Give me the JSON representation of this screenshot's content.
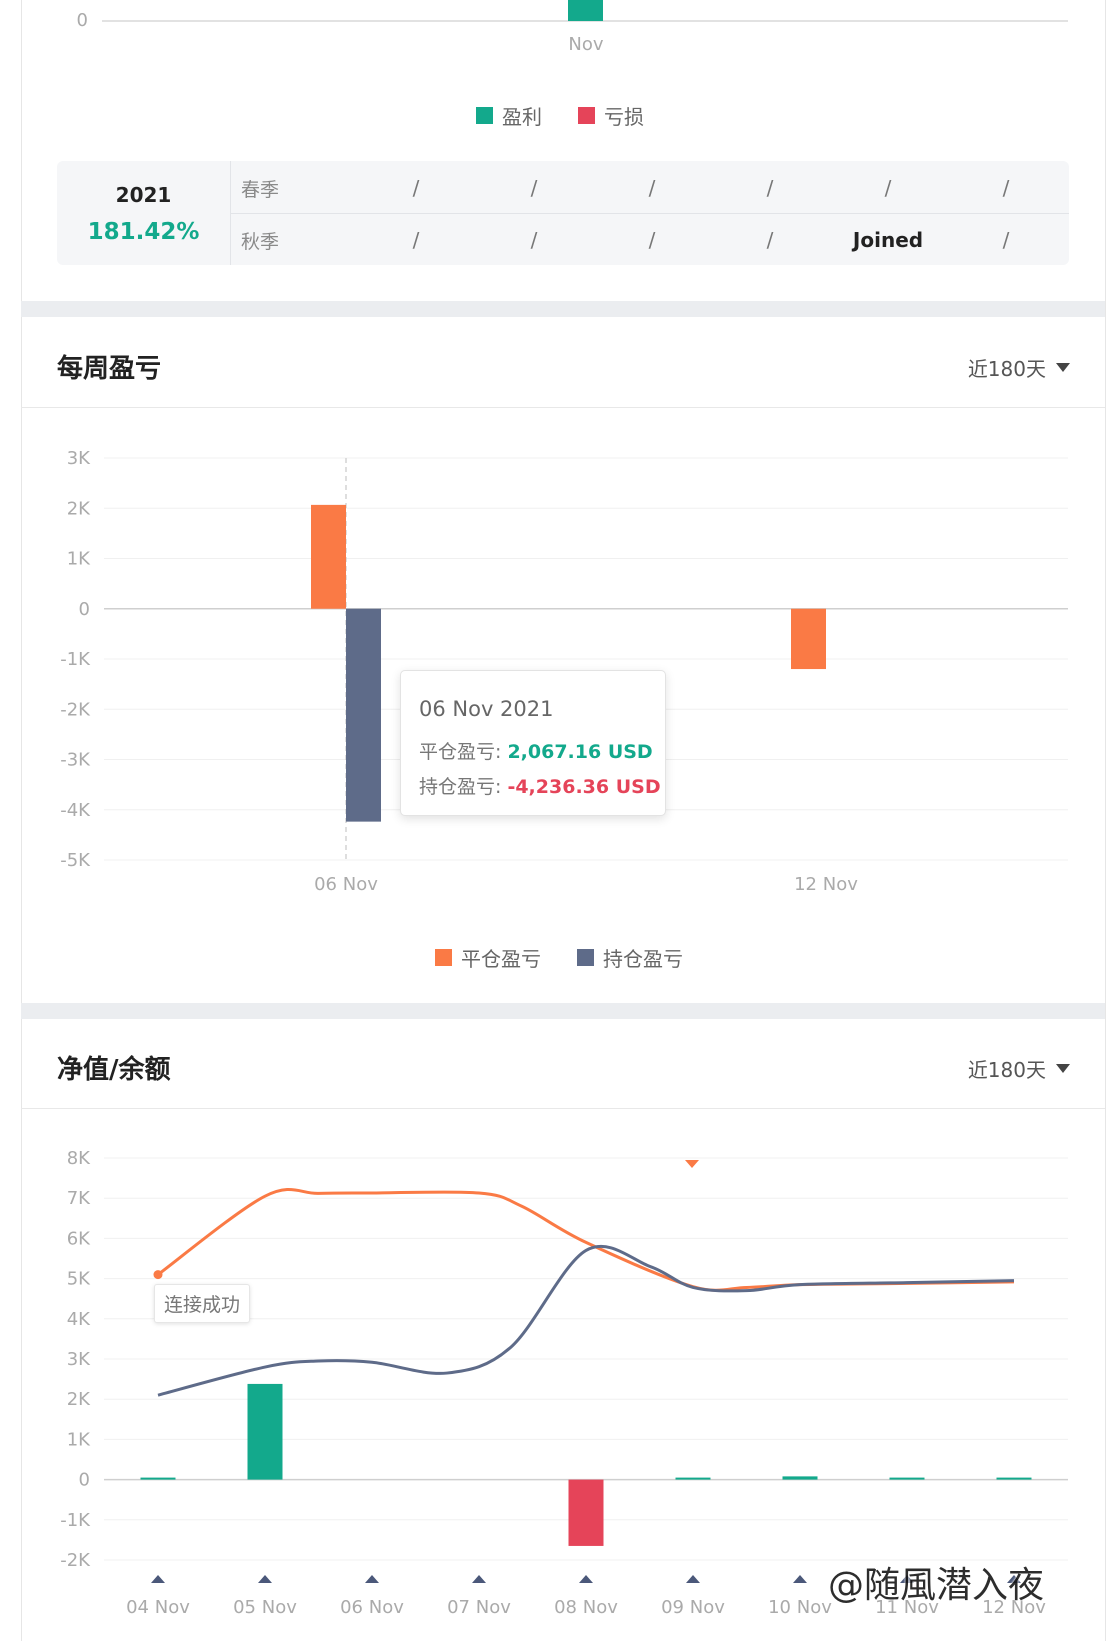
{
  "top_chart": {
    "y_ticks": [
      "0"
    ],
    "x_label": "Nov",
    "bar_value": 0.4,
    "legend": [
      {
        "label": "盈利",
        "color": "#13a98c"
      },
      {
        "label": "亏损",
        "color": "#e54459"
      }
    ]
  },
  "season_table": {
    "year": "2021",
    "percent": "181.42%",
    "rows": [
      {
        "label": "春季",
        "cells": [
          "/",
          "/",
          "/",
          "/",
          "/",
          "/"
        ]
      },
      {
        "label": "秋季",
        "cells": [
          "/",
          "/",
          "/",
          "/",
          "Joined",
          "/"
        ]
      }
    ]
  },
  "weekly_section": {
    "title": "每周盈亏",
    "range": "近180天",
    "tooltip": {
      "date": "06 Nov 2021",
      "closed_label": "平仓盈亏:",
      "closed_value": "2,067.16 USD",
      "open_label": "持仓盈亏:",
      "open_value": "-4,236.36 USD"
    }
  },
  "equity_section": {
    "title": "净值/余额",
    "range": "近180天",
    "tag": "连接成功"
  },
  "watermark": "@随風潜入夜",
  "chart_data": [
    {
      "type": "bar",
      "categories": [
        "06 Nov",
        "12 Nov"
      ],
      "y_ticks": [
        "3K",
        "2K",
        "1K",
        "0",
        "-1K",
        "-2K",
        "-3K",
        "-4K",
        "-5K"
      ],
      "ylim": [
        -5000,
        3000
      ],
      "grid": true,
      "legend_position": "bottom",
      "series": [
        {
          "name": "平仓盈亏",
          "color": "#fa7a45",
          "values": [
            2067.16,
            -1200
          ]
        },
        {
          "name": "持仓盈亏",
          "color": "#5e6b89",
          "values": [
            -4236.36,
            0
          ]
        }
      ]
    },
    {
      "type": "line",
      "x": [
        "04 Nov",
        "05 Nov",
        "06 Nov",
        "07 Nov",
        "08 Nov",
        "09 Nov",
        "10 Nov",
        "11 Nov",
        "12 Nov"
      ],
      "y_ticks": [
        "8K",
        "7K",
        "6K",
        "5K",
        "4K",
        "3K",
        "2K",
        "1K",
        "0",
        "-1K",
        "-2K"
      ],
      "ylim": [
        -2000,
        8000
      ],
      "grid": true,
      "lines": [
        {
          "color": "#fa7a45",
          "points": [
            [
              0,
              5100
            ],
            [
              1,
              7050
            ],
            [
              1.5,
              7120
            ],
            [
              2,
              7130
            ],
            [
              3,
              7130
            ],
            [
              3.4,
              6800
            ],
            [
              4,
              5900
            ],
            [
              5,
              4800
            ],
            [
              5.5,
              4780
            ],
            [
              6,
              4850
            ],
            [
              7,
              4880
            ],
            [
              8,
              4920
            ]
          ]
        },
        {
          "color": "#5e6b89",
          "points": [
            [
              0,
              2100
            ],
            [
              1,
              2800
            ],
            [
              1.5,
              2950
            ],
            [
              2,
              2920
            ],
            [
              2.7,
              2650
            ],
            [
              3.3,
              3300
            ],
            [
              4,
              5700
            ],
            [
              4.6,
              5300
            ],
            [
              5,
              4780
            ],
            [
              5.5,
              4700
            ],
            [
              6,
              4850
            ],
            [
              7,
              4900
            ],
            [
              8,
              4950
            ]
          ]
        }
      ],
      "bars": [
        {
          "color_pos": "#13a98c",
          "color_neg": "#e54459",
          "values": [
            30,
            2380,
            0,
            0,
            -1650,
            40,
            80,
            30,
            10
          ]
        }
      ]
    }
  ]
}
